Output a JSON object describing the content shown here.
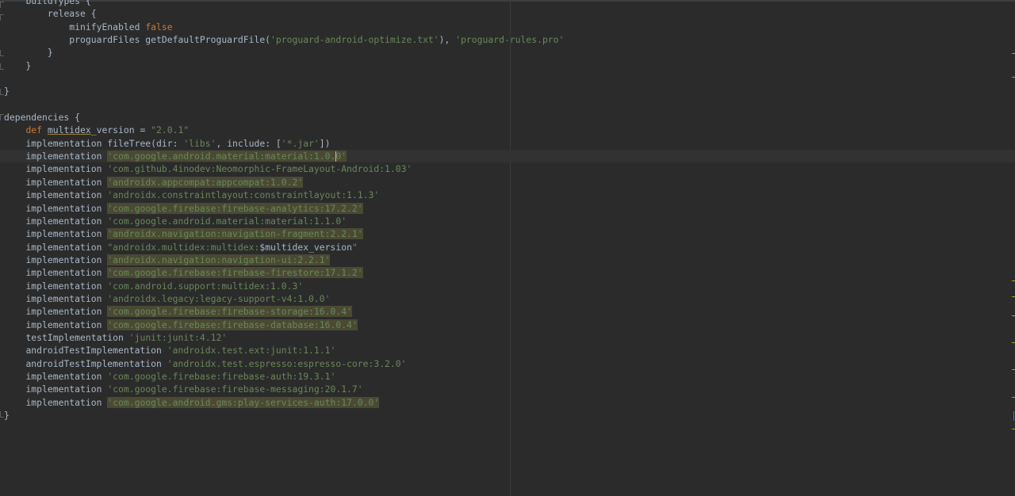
{
  "editor": {
    "lines": [
      {
        "indent": "    ",
        "tokens": [
          {
            "t": "buildTypes {",
            "c": "ident"
          }
        ]
      },
      {
        "indent": "        ",
        "tokens": [
          {
            "t": "release {",
            "c": "ident"
          }
        ]
      },
      {
        "indent": "            ",
        "tokens": [
          {
            "t": "minifyEnabled ",
            "c": "ident"
          },
          {
            "t": "false",
            "c": "kw"
          }
        ]
      },
      {
        "indent": "            ",
        "tokens": [
          {
            "t": "proguardFiles getDefaultProguardFile(",
            "c": "ident"
          },
          {
            "t": "'proguard-android-optimize.txt'",
            "c": "str"
          },
          {
            "t": "), ",
            "c": "ident"
          },
          {
            "t": "'proguard-rules.pro'",
            "c": "str"
          }
        ]
      },
      {
        "indent": "        ",
        "tokens": [
          {
            "t": "}",
            "c": "ident"
          }
        ]
      },
      {
        "indent": "    ",
        "tokens": [
          {
            "t": "}",
            "c": "ident"
          }
        ]
      },
      {
        "indent": "",
        "tokens": []
      },
      {
        "indent": "",
        "tokens": [
          {
            "t": "}",
            "c": "ident"
          }
        ]
      },
      {
        "indent": "",
        "tokens": []
      },
      {
        "indent": "",
        "tokens": [
          {
            "t": "dependencies {",
            "c": "ident"
          }
        ]
      },
      {
        "indent": "    ",
        "tokens": [
          {
            "t": "def ",
            "c": "kw"
          },
          {
            "t": "multidex",
            "c": "ident squiggle"
          },
          {
            "t": "_version = ",
            "c": "ident"
          },
          {
            "t": "\"2.0.1\"",
            "c": "str"
          }
        ]
      },
      {
        "indent": "    ",
        "tokens": [
          {
            "t": "implementation fileTree(",
            "c": "ident"
          },
          {
            "t": "dir: ",
            "c": "ident"
          },
          {
            "t": "'libs'",
            "c": "str"
          },
          {
            "t": ", include: [",
            "c": "ident"
          },
          {
            "t": "'*.jar'",
            "c": "str"
          },
          {
            "t": "])",
            "c": "ident"
          }
        ]
      },
      {
        "indent": "    ",
        "caret": true,
        "tokens": [
          {
            "t": "implementation ",
            "c": "ident"
          },
          {
            "t": "'com.google.android.material:material:1.0.0'",
            "c": "str-hl"
          }
        ]
      },
      {
        "indent": "    ",
        "tokens": [
          {
            "t": "implementation ",
            "c": "ident"
          },
          {
            "t": "'com.github.4inodev:Neomorphic-FrameLayout-Android:1.03'",
            "c": "str"
          }
        ]
      },
      {
        "indent": "    ",
        "tokens": [
          {
            "t": "implementation ",
            "c": "ident"
          },
          {
            "t": "'androidx.appcompat:appcompat:1.0.2'",
            "c": "str-hl"
          }
        ]
      },
      {
        "indent": "    ",
        "tokens": [
          {
            "t": "implementation ",
            "c": "ident"
          },
          {
            "t": "'androidx.constraintlayout:constraintlayout:1.1.3'",
            "c": "str"
          }
        ]
      },
      {
        "indent": "    ",
        "tokens": [
          {
            "t": "implementation ",
            "c": "ident"
          },
          {
            "t": "'com.google.firebase:firebase-analytics:17.2.2'",
            "c": "str-hl"
          }
        ]
      },
      {
        "indent": "    ",
        "tokens": [
          {
            "t": "implementation ",
            "c": "ident"
          },
          {
            "t": "'com.google.android.material:material:1.1.0'",
            "c": "str"
          }
        ]
      },
      {
        "indent": "    ",
        "tokens": [
          {
            "t": "implementation ",
            "c": "ident"
          },
          {
            "t": "'androidx.navigation:navigation-fragment:2.2.1'",
            "c": "str-hl"
          }
        ]
      },
      {
        "indent": "    ",
        "tokens": [
          {
            "t": "implementation ",
            "c": "ident"
          },
          {
            "t": "\"androidx.multidex:multidex:",
            "c": "str"
          },
          {
            "t": "$multidex_version",
            "c": "ident"
          },
          {
            "t": "\"",
            "c": "str"
          }
        ]
      },
      {
        "indent": "    ",
        "tokens": [
          {
            "t": "implementation ",
            "c": "ident"
          },
          {
            "t": "'androidx.navigation:navigation-ui:2.2.1'",
            "c": "str-hl"
          }
        ]
      },
      {
        "indent": "    ",
        "tokens": [
          {
            "t": "implementation ",
            "c": "ident"
          },
          {
            "t": "'com.google.firebase:firebase-firestore:17.1.2'",
            "c": "str-hl"
          }
        ]
      },
      {
        "indent": "    ",
        "tokens": [
          {
            "t": "implementation ",
            "c": "ident"
          },
          {
            "t": "'com.android.support:multidex:1.0.3'",
            "c": "str"
          }
        ]
      },
      {
        "indent": "    ",
        "tokens": [
          {
            "t": "implementation ",
            "c": "ident"
          },
          {
            "t": "'androidx.legacy:legacy-support-v4:1.0.0'",
            "c": "str"
          }
        ]
      },
      {
        "indent": "    ",
        "tokens": [
          {
            "t": "implementation ",
            "c": "ident"
          },
          {
            "t": "'com.google.firebase:firebase-storage:16.0.4'",
            "c": "str-hl"
          }
        ]
      },
      {
        "indent": "    ",
        "tokens": [
          {
            "t": "implementation ",
            "c": "ident"
          },
          {
            "t": "'com.google.firebase:firebase-database:16.0.4'",
            "c": "str-hl"
          }
        ]
      },
      {
        "indent": "    ",
        "tokens": [
          {
            "t": "testImplementation ",
            "c": "ident"
          },
          {
            "t": "'junit:junit:4.12'",
            "c": "str"
          }
        ]
      },
      {
        "indent": "    ",
        "tokens": [
          {
            "t": "androidTestImplementation ",
            "c": "ident"
          },
          {
            "t": "'androidx.test.ext:junit:1.1.1'",
            "c": "str"
          }
        ]
      },
      {
        "indent": "    ",
        "tokens": [
          {
            "t": "androidTestImplementation ",
            "c": "ident"
          },
          {
            "t": "'androidx.test.espresso:espresso-core:3.2.0'",
            "c": "str"
          }
        ]
      },
      {
        "indent": "    ",
        "tokens": [
          {
            "t": "implementation ",
            "c": "ident"
          },
          {
            "t": "'com.google.firebase:firebase-auth:19.3.1'",
            "c": "str"
          }
        ]
      },
      {
        "indent": "    ",
        "tokens": [
          {
            "t": "implementation ",
            "c": "ident"
          },
          {
            "t": "'com.google.firebase:firebase-messaging:20.1.7'",
            "c": "str"
          }
        ]
      },
      {
        "indent": "    ",
        "tokens": [
          {
            "t": "implementation ",
            "c": "ident"
          },
          {
            "t": "'com.google.android.gms:play-services-auth:17.0.0'",
            "c": "str-hl"
          }
        ]
      },
      {
        "indent": "",
        "tokens": [
          {
            "t": "}",
            "c": "ident"
          }
        ]
      }
    ]
  },
  "icons": {
    "intention_bulb": "lightbulb-icon",
    "fold": "fold-marker-icon"
  },
  "colors": {
    "background": "#2b2b2b",
    "text": "#a9b7c6",
    "keyword": "#cc7832",
    "string": "#6a8759",
    "string_highlight_bg": "#4a4a34",
    "caret_row": "#323232",
    "bulb": "#e5c07b"
  }
}
